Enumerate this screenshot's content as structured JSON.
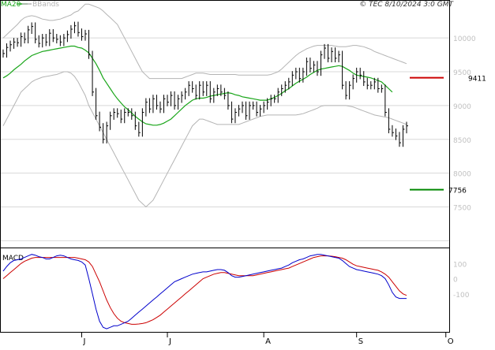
{
  "header": {
    "legend_ma": "MA20",
    "legend_bb": "BBands",
    "copyright": "© TEC 8/10/2024 3:0 GMT"
  },
  "colors": {
    "ma": "#1aa61a",
    "bb": "#b4b4b4",
    "resistance": "#cc0000",
    "support": "#008800",
    "macd": "#0000cc",
    "signal": "#cc0000",
    "grid": "#d8d8d8",
    "candle": "#000000"
  },
  "chart_data": [
    {
      "type": "line",
      "panel": "price",
      "y_ticks": [
        10000,
        9500,
        9000,
        8500,
        8000,
        7500
      ],
      "y_tick_labels": [
        "10000",
        "9500",
        "9000",
        "8500",
        "8000",
        "7500"
      ],
      "ylim": [
        6900,
        10550
      ],
      "x_labels": [
        "J",
        "J",
        "A",
        "S",
        "O"
      ],
      "x_label_index": [
        22,
        46,
        73,
        99,
        124
      ],
      "levels": [
        {
          "name": "resistance",
          "value": 9411,
          "label": "9411",
          "from_index": 129,
          "to_index": 140
        },
        {
          "name": "support",
          "value": 7756,
          "label": "7756",
          "from_index": 129,
          "to_index": 140
        }
      ],
      "close": [
        9770,
        9860,
        9900,
        9940,
        9930,
        10020,
        9980,
        10120,
        10170,
        9980,
        9920,
        10000,
        9940,
        10070,
        10000,
        9980,
        9940,
        10000,
        10050,
        10130,
        10180,
        10080,
        10020,
        10060,
        9750,
        9200,
        8850,
        8680,
        8500,
        8700,
        8850,
        8900,
        8880,
        8800,
        8900,
        8900,
        8850,
        8700,
        8600,
        8900,
        9050,
        8950,
        9100,
        9000,
        8950,
        9100,
        9050,
        9150,
        9000,
        9100,
        9150,
        9200,
        9300,
        9250,
        9150,
        9300,
        9200,
        9300,
        9100,
        9200,
        9250,
        9200,
        9150,
        9000,
        8800,
        8900,
        8950,
        9000,
        8850,
        9000,
        9000,
        8900,
        8950,
        9000,
        9050,
        9100,
        9100,
        9200,
        9250,
        9300,
        9350,
        9450,
        9500,
        9400,
        9500,
        9650,
        9550,
        9600,
        9500,
        9750,
        9850,
        9700,
        9800,
        9700,
        9750,
        9300,
        9150,
        9300,
        9400,
        9500,
        9450,
        9350,
        9300,
        9300,
        9350,
        9250,
        9250,
        8900,
        8650,
        8600,
        8550,
        8450,
        8650,
        8700
      ],
      "ma20": [
        9410,
        9440,
        9480,
        9530,
        9570,
        9610,
        9660,
        9700,
        9740,
        9760,
        9780,
        9800,
        9810,
        9820,
        9830,
        9840,
        9850,
        9860,
        9870,
        9880,
        9880,
        9860,
        9850,
        9820,
        9780,
        9700,
        9620,
        9520,
        9410,
        9330,
        9250,
        9170,
        9100,
        9040,
        8980,
        8940,
        8890,
        8840,
        8800,
        8760,
        8730,
        8720,
        8710,
        8710,
        8720,
        8740,
        8770,
        8800,
        8850,
        8900,
        8950,
        9000,
        9040,
        9080,
        9100,
        9110,
        9110,
        9120,
        9140,
        9150,
        9160,
        9170,
        9180,
        9190,
        9180,
        9160,
        9150,
        9130,
        9120,
        9110,
        9100,
        9090,
        9080,
        9080,
        9080,
        9100,
        9120,
        9150,
        9180,
        9220,
        9250,
        9290,
        9330,
        9360,
        9390,
        9420,
        9460,
        9490,
        9520,
        9540,
        9550,
        9560,
        9570,
        9580,
        9590,
        9580,
        9550,
        9520,
        9480,
        9450,
        9440,
        9430,
        9420,
        9410,
        9390,
        9370,
        9350,
        9300,
        9250,
        9200
      ],
      "bb_upper": [
        10000,
        10050,
        10100,
        10150,
        10200,
        10260,
        10300,
        10320,
        10330,
        10320,
        10300,
        10280,
        10270,
        10260,
        10260,
        10270,
        10280,
        10300,
        10320,
        10340,
        10380,
        10400,
        10450,
        10500,
        10500,
        10480,
        10460,
        10440,
        10400,
        10350,
        10300,
        10250,
        10200,
        10100,
        10000,
        9900,
        9800,
        9700,
        9600,
        9500,
        9450,
        9400,
        9400,
        9400,
        9400,
        9400,
        9400,
        9400,
        9400,
        9400,
        9400,
        9420,
        9440,
        9460,
        9480,
        9480,
        9480,
        9470,
        9460,
        9460,
        9460,
        9460,
        9460,
        9460,
        9460,
        9460,
        9450,
        9450,
        9450,
        9450,
        9450,
        9450,
        9450,
        9450,
        9450,
        9460,
        9480,
        9500,
        9540,
        9590,
        9640,
        9690,
        9740,
        9780,
        9810,
        9840,
        9860,
        9880,
        9890,
        9890,
        9890,
        9890,
        9890,
        9880,
        9870,
        9870,
        9870,
        9880,
        9890,
        9890,
        9880,
        9870,
        9850,
        9830,
        9800,
        9780,
        9760,
        9740,
        9720,
        9700,
        9680,
        9660,
        9640,
        9620
      ],
      "bb_lower": [
        8700,
        8800,
        8900,
        9000,
        9100,
        9200,
        9250,
        9300,
        9350,
        9380,
        9400,
        9420,
        9430,
        9440,
        9450,
        9460,
        9480,
        9500,
        9500,
        9480,
        9430,
        9350,
        9250,
        9150,
        9000,
        8900,
        8800,
        8700,
        8600,
        8500,
        8400,
        8300,
        8200,
        8100,
        8000,
        7900,
        7800,
        7700,
        7600,
        7550,
        7500,
        7550,
        7600,
        7700,
        7800,
        7900,
        8000,
        8100,
        8200,
        8300,
        8400,
        8500,
        8600,
        8700,
        8750,
        8800,
        8800,
        8780,
        8760,
        8740,
        8720,
        8720,
        8720,
        8720,
        8720,
        8720,
        8720,
        8740,
        8760,
        8780,
        8800,
        8820,
        8840,
        8850,
        8860,
        8860,
        8860,
        8860,
        8860,
        8860,
        8860,
        8860,
        8860,
        8870,
        8880,
        8900,
        8920,
        8940,
        8960,
        8990,
        9000,
        9000,
        9000,
        9000,
        9000,
        9000,
        9000,
        8990,
        8980,
        8960,
        8940,
        8920,
        8900,
        8880,
        8860,
        8850,
        8840,
        8830,
        8820,
        8800,
        8780,
        8760,
        8740,
        8720
      ]
    },
    {
      "type": "line",
      "panel": "macd",
      "title": "MACD",
      "y_ticks": [
        100,
        0,
        -100
      ],
      "y_tick_labels": [
        "100",
        "0",
        "-100"
      ],
      "ylim": [
        -350,
        200
      ],
      "macd": [
        50,
        80,
        105,
        120,
        125,
        130,
        140,
        150,
        160,
        155,
        145,
        140,
        130,
        130,
        140,
        150,
        155,
        150,
        140,
        130,
        125,
        120,
        110,
        90,
        0,
        -100,
        -200,
        -280,
        -320,
        -330,
        -320,
        -310,
        -310,
        -300,
        -290,
        -280,
        -260,
        -240,
        -220,
        -200,
        -180,
        -160,
        -140,
        -120,
        -100,
        -80,
        -60,
        -40,
        -20,
        -10,
        0,
        10,
        20,
        30,
        35,
        40,
        45,
        45,
        50,
        55,
        60,
        60,
        55,
        40,
        20,
        10,
        10,
        15,
        20,
        25,
        30,
        35,
        40,
        45,
        50,
        55,
        60,
        65,
        70,
        80,
        90,
        105,
        115,
        125,
        130,
        140,
        150,
        155,
        160,
        160,
        155,
        150,
        145,
        140,
        135,
        120,
        100,
        80,
        70,
        60,
        55,
        50,
        45,
        40,
        35,
        30,
        20,
        0,
        -40,
        -90,
        -120,
        -130,
        -130,
        -130
      ],
      "signal": [
        0,
        20,
        40,
        60,
        80,
        100,
        115,
        125,
        135,
        140,
        140,
        140,
        140,
        140,
        140,
        140,
        140,
        140,
        140,
        140,
        140,
        135,
        130,
        125,
        110,
        80,
        30,
        -20,
        -80,
        -140,
        -190,
        -230,
        -260,
        -280,
        -290,
        -295,
        -300,
        -300,
        -298,
        -295,
        -290,
        -280,
        -270,
        -255,
        -240,
        -220,
        -200,
        -180,
        -160,
        -140,
        -120,
        -100,
        -80,
        -60,
        -40,
        -20,
        0,
        10,
        20,
        30,
        35,
        40,
        40,
        35,
        30,
        25,
        20,
        20,
        20,
        20,
        20,
        25,
        30,
        35,
        40,
        45,
        50,
        55,
        60,
        65,
        70,
        80,
        90,
        100,
        110,
        120,
        130,
        140,
        145,
        150,
        150,
        150,
        148,
        145,
        140,
        135,
        125,
        110,
        95,
        85,
        80,
        75,
        70,
        65,
        60,
        55,
        45,
        30,
        10,
        -20,
        -50,
        -80,
        -100,
        -110
      ]
    }
  ]
}
